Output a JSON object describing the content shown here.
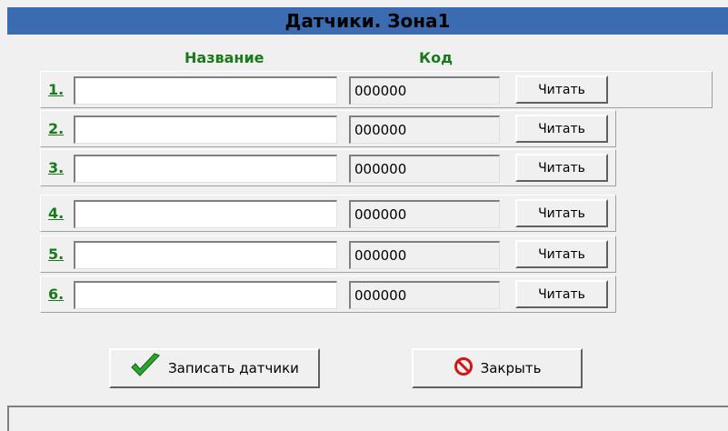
{
  "window": {
    "title": "Датчики. Зона1"
  },
  "columns": {
    "name": "Название",
    "code": "Код"
  },
  "rows": [
    {
      "num": "1.",
      "name": "",
      "code": "000000",
      "read": "Читать"
    },
    {
      "num": "2.",
      "name": "",
      "code": "000000",
      "read": "Читать"
    },
    {
      "num": "3.",
      "name": "",
      "code": "000000",
      "read": "Читать"
    },
    {
      "num": "4.",
      "name": "",
      "code": "000000",
      "read": "Читать"
    },
    {
      "num": "5.",
      "name": "",
      "code": "000000",
      "read": "Читать"
    },
    {
      "num": "6.",
      "name": "",
      "code": "000000",
      "read": "Читать"
    }
  ],
  "actions": {
    "write": "Записать датчики",
    "close": "Закрыть"
  },
  "icons": {
    "write": "checkmark-icon",
    "close": "prohibited-icon"
  },
  "colors": {
    "title_bar": "#3b6bb0",
    "label_green": "#1a7a1a",
    "close_red": "#d01818",
    "check_green": "#2ea52e"
  }
}
